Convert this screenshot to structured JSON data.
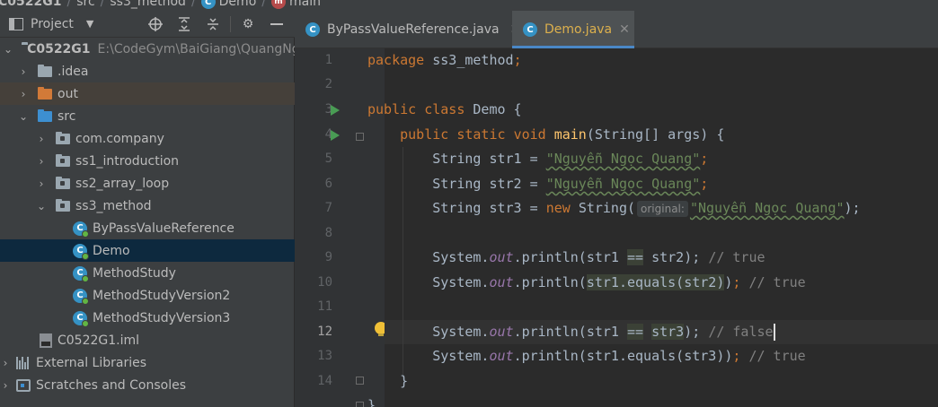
{
  "breadcrumb": {
    "project": "C0522G1",
    "src": "src",
    "package": "ss3_method",
    "class": "Demo",
    "method": "main"
  },
  "project_panel": {
    "title": "Project",
    "tree": [
      {
        "label": "C0522G1",
        "path": "E:\\CodeGym\\BaiGiang\\QuangNguyen"
      },
      {
        "label": ".idea"
      },
      {
        "label": "out"
      },
      {
        "label": "src"
      },
      {
        "label": "com.company"
      },
      {
        "label": "ss1_introduction"
      },
      {
        "label": "ss2_array_loop"
      },
      {
        "label": "ss3_method"
      },
      {
        "label": "ByPassValueReference"
      },
      {
        "label": "Demo"
      },
      {
        "label": "MethodStudy"
      },
      {
        "label": "MethodStudyVersion2"
      },
      {
        "label": "MethodStudyVersion3"
      },
      {
        "label": "C0522G1.iml"
      },
      {
        "label": "External Libraries"
      },
      {
        "label": "Scratches and Consoles"
      }
    ]
  },
  "tabs": [
    {
      "label": "ByPassValueReference.java"
    },
    {
      "label": "Demo.java"
    }
  ],
  "editor": {
    "line_numbers": [
      "1",
      "2",
      "3",
      "4",
      "5",
      "6",
      "7",
      "8",
      "9",
      "10",
      "11",
      "12",
      "13",
      "14"
    ],
    "current_line": "12",
    "tokens": {
      "package_kw": "package",
      "package_name": "ss3_method",
      "semicolon": ";",
      "public": "public",
      "class": "class",
      "static": "static",
      "void": "void",
      "new": "new",
      "class_name": "Demo",
      "open_brace": " {",
      "main": "main",
      "main_params": "(String[] args) {",
      "string_type": "String",
      "str1": "str1",
      "str2": "str2",
      "str3": "str3",
      "assign": " = ",
      "string_literal": "\"Nguyễn Ngọc Quang\"",
      "string_ctor": "String(",
      "hint_original": "original:",
      "close_paren_semi": ");",
      "system": "System.",
      "out": "out",
      "println": ".println(",
      "eq": "==",
      "equals_str2": "str1.equals(str2)",
      "equals_str3": "str1.equals(str3)",
      "comment_true": "// true",
      "comment_false": "// false",
      "close_brace": "}"
    }
  },
  "colors": {
    "keyword": "#cc7832",
    "string": "#6a8759",
    "function": "#ffc66d",
    "field": "#9876aa",
    "comment": "#808080",
    "accent": "#4a88c7"
  }
}
